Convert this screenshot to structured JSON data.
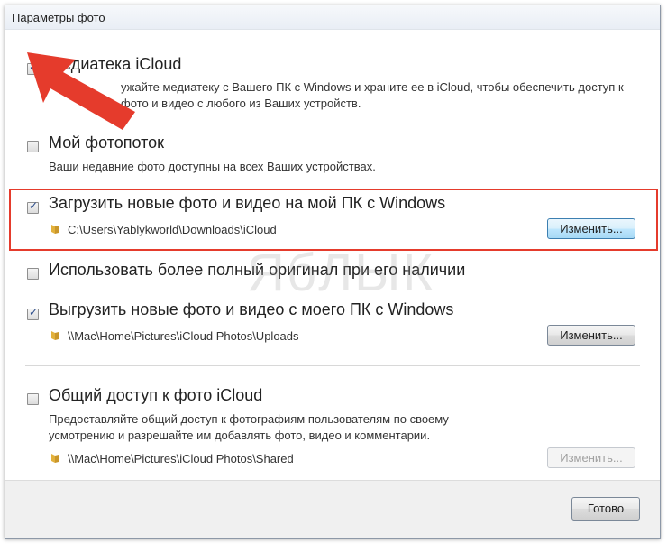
{
  "window": {
    "title": "Параметры фото"
  },
  "options": {
    "library": {
      "title": "Медиатека iCloud",
      "description": "Храните всю медиатеку с Вашего ПК с Windows и храните ее в iCloud, чтобы обеспечить доступ к фото и видео с любого из Ваших устройств.",
      "description_visible": "ужайте медиатеку с Вашего ПК с Windows и храните ее в iCloud, чтобы обеспечить доступ к фото и видео с любого из Ваших устройств.",
      "checked": true
    },
    "photostream": {
      "title": "Мой фотопоток",
      "description": "Ваши недавние фото доступны на всех Ваших устройствах.",
      "checked": false
    },
    "download": {
      "title": "Загрузить новые фото и видео на мой ПК с Windows",
      "path": "C:\\Users\\Yablykworld\\Downloads\\iCloud",
      "change_label": "Изменить...",
      "checked": true
    },
    "original": {
      "title": "Использовать более полный оригинал при его наличии",
      "checked": false
    },
    "upload": {
      "title": "Выгрузить новые фото и видео с моего ПК с Windows",
      "path": "\\\\Mac\\Home\\Pictures\\iCloud Photos\\Uploads",
      "change_label": "Изменить...",
      "checked": true
    },
    "sharing": {
      "title": "Общий доступ к фото iCloud",
      "description": "Предоставляйте общий доступ к фотографиям пользователям по своему усмотрению и разрешайте им добавлять фото, видео и комментарии.",
      "path": "\\\\Mac\\Home\\Pictures\\iCloud Photos\\Shared",
      "change_label": "Изменить...",
      "checked": false
    }
  },
  "footer": {
    "done_label": "Готово"
  },
  "watermark": "ЯбЛЫК",
  "colors": {
    "highlight": "#e53b2c",
    "arrow": "#e53b2c",
    "folder": "#e2b13c"
  }
}
